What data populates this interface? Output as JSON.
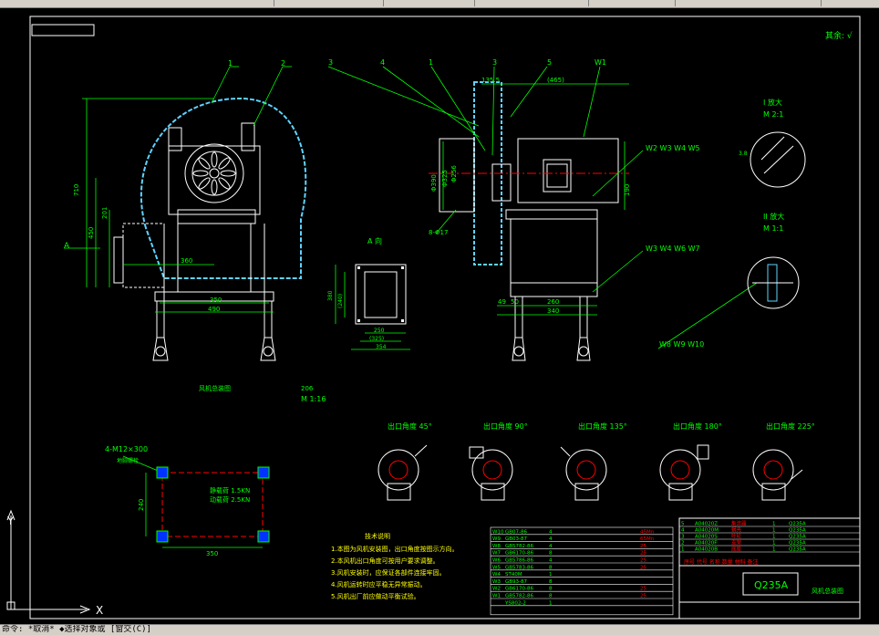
{
  "window": {
    "status_text": "命令: *取消*  ◆选择对象或 [窗交(C)]"
  },
  "drawing": {
    "roughness_mark": "其余: √",
    "callouts": [
      "1",
      "2",
      "3",
      "4",
      "1",
      "3",
      "5",
      "W1"
    ],
    "weld_callouts": {
      "a": "W2  W3  W4  W5",
      "b": "W3  W4  W6  W7",
      "c": "W8  W9  W10"
    },
    "dims_front": [
      "710",
      "450",
      "201",
      "360",
      "350",
      "490"
    ],
    "dims_side": [
      "135.5",
      "(465)",
      "190",
      "49",
      "50",
      "260",
      "340",
      "8-Φ17",
      "Φ390",
      "Φ325",
      "Φ256"
    ],
    "view_A_title": "A  向",
    "view_A_dims": [
      "380",
      "(240)",
      "250",
      "(325)",
      "354",
      "172",
      "206"
    ],
    "arrow_label": "A",
    "front_caption": "风机总装图",
    "front_scale": "M 1:16",
    "detail_I_title": "I  放大",
    "detail_I_scale": "M 2:1",
    "detail_I_dim": "3.8",
    "detail_II_title": "II  放大",
    "detail_II_scale": "M 1:1",
    "orientations": [
      "出口角度 45°",
      "出口角度 90°",
      "出口角度 135°",
      "出口角度 180°",
      "出口角度 225°"
    ],
    "foundation_label": "4-M12×300",
    "foundation_sub": "地脚螺栓",
    "load_labels": [
      "静载荷 1.5KN",
      "动载荷 2.5KN"
    ],
    "foundation_dims": [
      "240",
      "350"
    ],
    "notes_title": "技术说明",
    "notes": [
      "1.本图为风机安装图，出口角度按图示方向。",
      "2.本风机出口角度可按用户要求调整。",
      "3.风机安装时，应保证各部件连接牢固。",
      "4.风机运转时应平稳无异常振动。",
      "5.风机出厂前应做动平衡试验。"
    ],
    "weld_table": [
      [
        "W10",
        "GB07-86",
        "4",
        "",
        "",
        "",
        "45Mn"
      ],
      [
        "W9",
        "GB03-87",
        "4",
        "",
        "",
        "",
        "65Mn"
      ],
      [
        "W8",
        "GB5782-86",
        "4",
        "",
        "",
        "",
        "25"
      ],
      [
        "W7",
        "GB6170-86",
        "8",
        "",
        "",
        "",
        "25"
      ],
      [
        "W6",
        "GB5786-86",
        "4",
        "",
        "",
        "",
        "25"
      ],
      [
        "W5",
        "GB5783-86",
        "8",
        "",
        "",
        "",
        "25"
      ],
      [
        "W4",
        "ST40M",
        "1",
        "",
        "",
        "",
        ""
      ],
      [
        "W3",
        "GB93-87",
        "8",
        "",
        "",
        "",
        ""
      ],
      [
        "W2",
        "GB6170-86",
        "8",
        "",
        "",
        "",
        "25"
      ],
      [
        "W1",
        "GB5782-86",
        "8",
        "",
        "",
        "",
        "25"
      ],
      [
        "",
        "YS802-2",
        "1",
        "",
        "",
        "",
        ""
      ]
    ],
    "parts_table": [
      [
        "5",
        "A04020Z",
        "集流器",
        "1",
        "Q235A",
        ""
      ],
      [
        "4",
        "A04020M",
        "蜗壳",
        "1",
        "Q235A",
        ""
      ],
      [
        "3",
        "A04020S",
        "叶轮",
        "1",
        "Q235A",
        ""
      ],
      [
        "2",
        "A04020F",
        "支架",
        "1",
        "Q235A",
        ""
      ],
      [
        "1",
        "A04020B",
        "底座",
        "1",
        "Q235A",
        ""
      ]
    ],
    "parts_header": "序号  代号  名称  数量  材料  备注",
    "material": "Q235A",
    "drawing_title": "风机总装图",
    "ucs_x": "X",
    "ucs_y": "Y"
  }
}
